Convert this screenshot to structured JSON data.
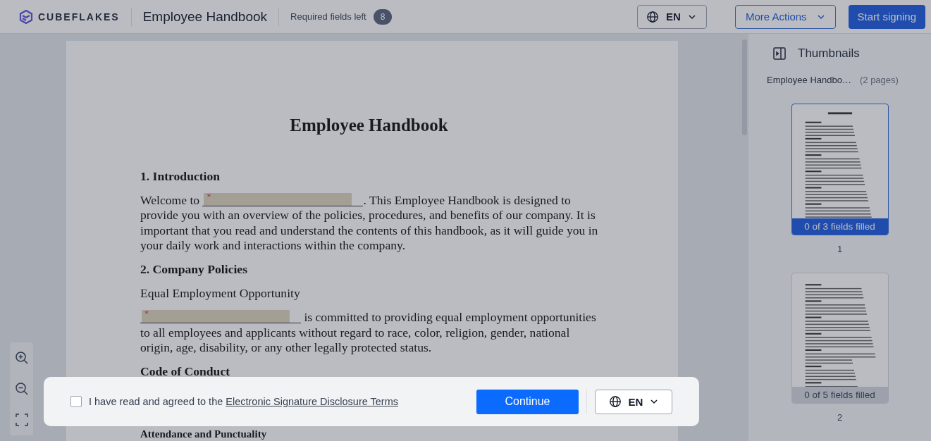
{
  "header": {
    "brand": "CUBEFLAKES",
    "title": "Employee Handbook",
    "required_label": "Required fields left",
    "required_count": "8",
    "language": "EN",
    "more_actions": "More Actions",
    "start": "Start signing"
  },
  "document": {
    "title": "Employee Handbook",
    "blocks": [
      {
        "kind": "heading",
        "text": "1. Introduction"
      },
      {
        "kind": "field_text",
        "before": "Welcome to ",
        "mark": "*",
        "after": ". This Employee Handbook is designed to provide you with an overview of the policies, procedures, and benefits of our company. It is important that you read and understand the contents of this handbook, as it will guide you in your daily work and interactions within the company."
      },
      {
        "kind": "heading",
        "text": "2. Company Policies"
      },
      {
        "kind": "text",
        "text": "Equal Employment Opportunity"
      },
      {
        "kind": "field_text",
        "mark": "*",
        "after": " is committed to providing equal employment opportunities to all employees and applicants without regard to race, color, religion, gender, national origin, age, disability, or any other legally protected status."
      },
      {
        "kind": "heading",
        "text": "Code of Conduct"
      },
      {
        "kind": "heading",
        "text": "Attendance and Punctuality"
      }
    ]
  },
  "thumbnails": {
    "title": "Thumbnails",
    "doc_name": "Employee Handbo…",
    "page_count": "(2 pages)",
    "pages": [
      {
        "status": "0 of 3 fields filled",
        "number": "1",
        "selected": true
      },
      {
        "status": "0 of 5 fields filled",
        "number": "2",
        "selected": false
      }
    ]
  },
  "consent": {
    "checked": false,
    "text": "I have read and agreed to the ",
    "link": "Electronic Signature Disclosure Terms",
    "button": "Continue",
    "language": "EN"
  }
}
